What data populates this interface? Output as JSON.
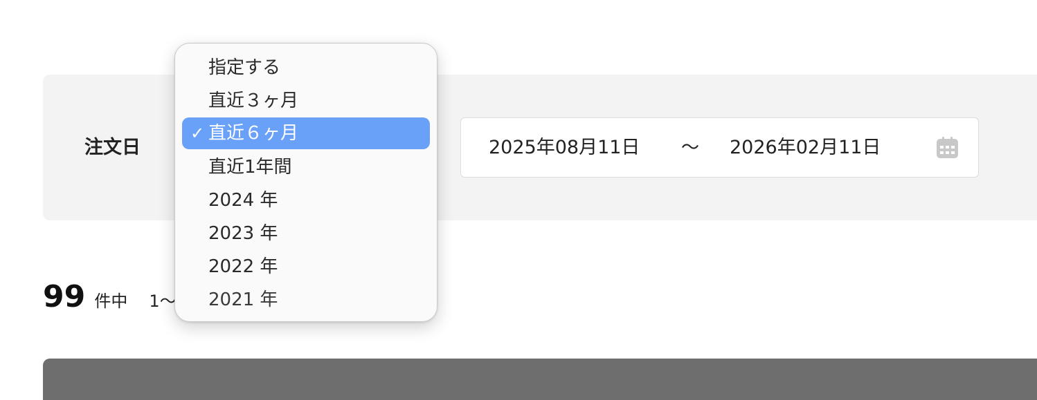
{
  "filter": {
    "label": "注文日",
    "date_start": "2025年08月11日",
    "date_separator": "〜",
    "date_end": "2026年02月11日",
    "calendar_icon": "calendar-icon"
  },
  "results": {
    "count": "99",
    "count_suffix": "件中",
    "range_prefix": "1〜"
  },
  "dropdown": {
    "selected_value": "直近６ヶ月",
    "items": [
      {
        "label": "指定する",
        "selected": false
      },
      {
        "label": "直近３ヶ月",
        "selected": false
      },
      {
        "label": "直近６ヶ月",
        "selected": true,
        "icon": "checkmark-icon"
      },
      {
        "label": "直近1年間",
        "selected": false
      },
      {
        "label": "2024 年",
        "selected": false
      },
      {
        "label": "2023 年",
        "selected": false
      },
      {
        "label": "2022 年",
        "selected": false
      },
      {
        "label": "2021 年",
        "selected": false
      }
    ],
    "check_glyph": "✓"
  },
  "colors": {
    "panel_bg": "#f3f3f3",
    "selected_bg": "#6aa1f8",
    "table_header_bg": "#6e6e6e",
    "icon_gray": "#c8c8c8"
  }
}
